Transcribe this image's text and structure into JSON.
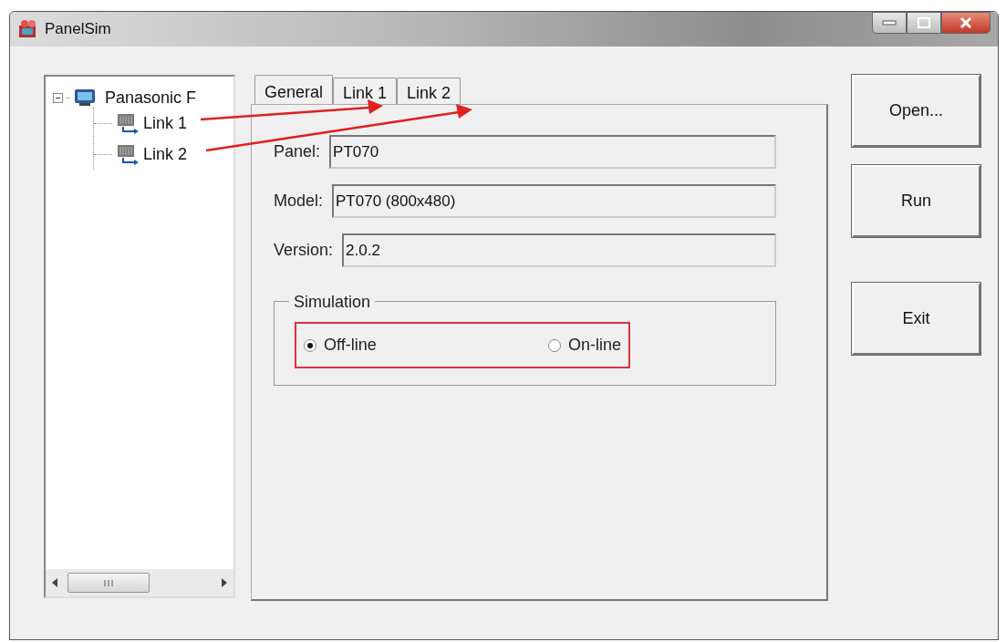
{
  "window": {
    "title": "PanelSim"
  },
  "tree": {
    "items": [
      {
        "label": "Panasonic F",
        "expanded": true,
        "children": [
          {
            "label": "Link 1"
          },
          {
            "label": "Link 2"
          }
        ]
      }
    ]
  },
  "tabs": [
    {
      "label": "General",
      "selected": true
    },
    {
      "label": "Link 1",
      "selected": false
    },
    {
      "label": "Link 2",
      "selected": false
    }
  ],
  "fields": [
    {
      "label": "Panel:",
      "value": "PT070"
    },
    {
      "label": "Model:",
      "value": "PT070 (800x480)"
    },
    {
      "label": "Version:",
      "value": "2.0.2"
    }
  ],
  "simulation": {
    "title": "Simulation",
    "options": [
      {
        "label": "Off-line",
        "selected": true
      },
      {
        "label": "On-line",
        "selected": false
      }
    ]
  },
  "buttons": [
    "Open...",
    "Run",
    "Exit"
  ]
}
